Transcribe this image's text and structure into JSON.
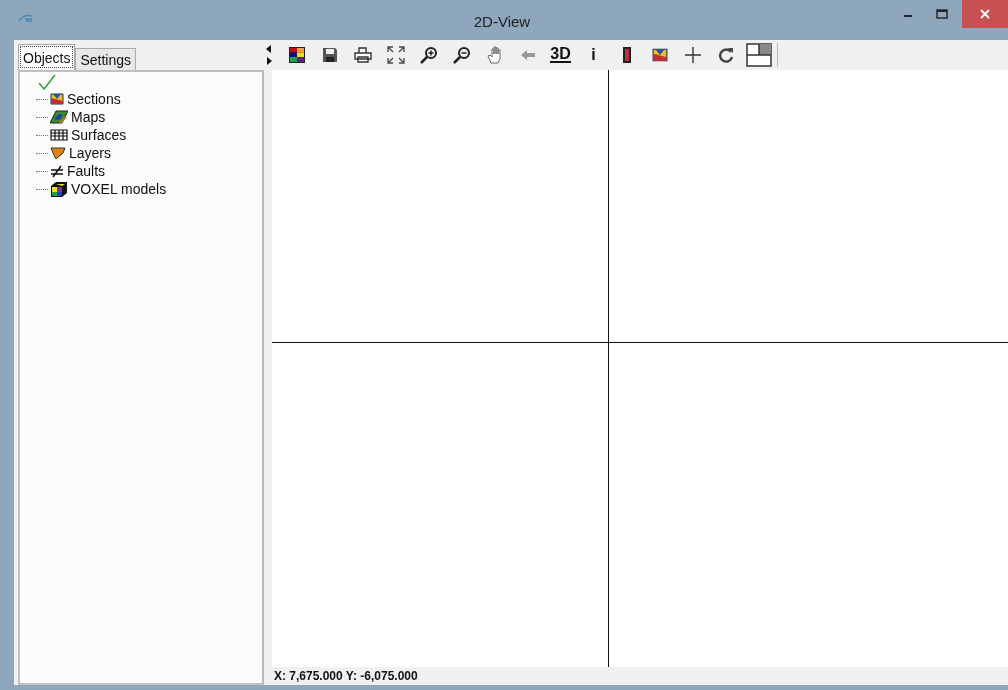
{
  "window": {
    "title": "2D-View"
  },
  "tabs": [
    {
      "label": "Objects",
      "selected": true
    },
    {
      "label": "Settings",
      "selected": false
    }
  ],
  "tree": {
    "checked": true,
    "children": [
      {
        "label": "Sections",
        "kind": "sections"
      },
      {
        "label": "Maps",
        "kind": "maps"
      },
      {
        "label": "Surfaces",
        "kind": "surfaces"
      },
      {
        "label": "Layers",
        "kind": "layers"
      },
      {
        "label": "Faults",
        "kind": "faults"
      },
      {
        "label": "VOXEL models",
        "kind": "voxel"
      }
    ]
  },
  "toolbar": [
    {
      "kind": "palette"
    },
    {
      "kind": "save"
    },
    {
      "kind": "print"
    },
    {
      "kind": "fit"
    },
    {
      "kind": "zoom-in"
    },
    {
      "kind": "zoom-out"
    },
    {
      "kind": "pan"
    },
    {
      "kind": "back"
    },
    {
      "kind": "text",
      "label": "3D",
      "underline": true
    },
    {
      "kind": "text",
      "label": "i",
      "underline": false
    },
    {
      "kind": "well"
    },
    {
      "kind": "sections"
    },
    {
      "kind": "cross"
    },
    {
      "kind": "refresh"
    },
    {
      "kind": "layout"
    }
  ],
  "status_bar": {
    "text": "X: 7,675.000 Y: -6,075.000"
  }
}
